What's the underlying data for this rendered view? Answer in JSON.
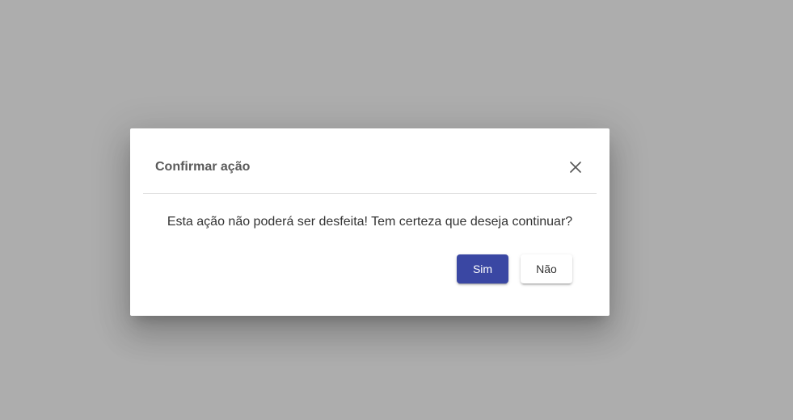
{
  "colors": {
    "backdrop": "#adadad",
    "primary": "#3a47a3",
    "title_text": "#5a5a5a",
    "body_text": "#333333"
  },
  "dialog": {
    "title": "Confirmar ação",
    "close_icon": "close-icon",
    "message": "Esta ação não poderá ser desfeita! Tem certeza que deseja continuar?",
    "actions": {
      "confirm_label": "Sim",
      "cancel_label": "Não"
    }
  }
}
